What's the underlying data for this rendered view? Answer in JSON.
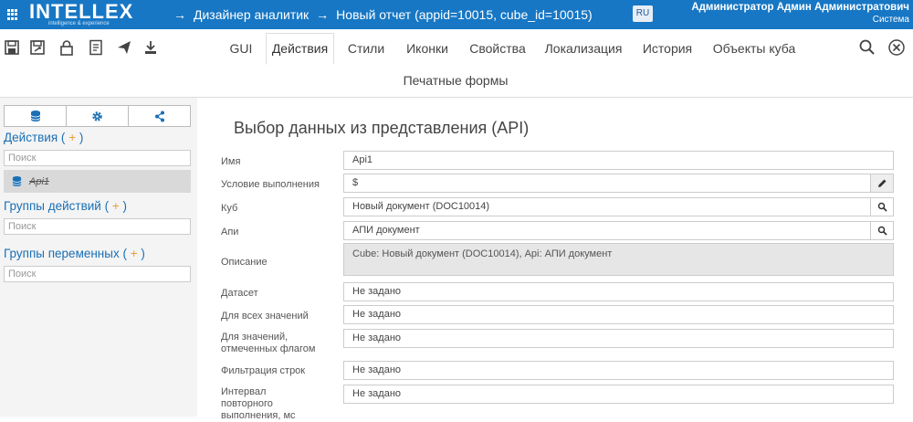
{
  "header": {
    "logo": "INTELLEX",
    "tagline": "intelligence & experience",
    "breadcrumb_1": "Дизайнер аналитик",
    "breadcrumb_2": "Новый отчет (appid=10015, cube_id=10015)",
    "arrow": "→",
    "lang": "RU",
    "user_name": "Администратор Админ Администратович",
    "user_role": "Система",
    "bg_color": "#1777c4"
  },
  "toolbar": {
    "icons": [
      "save-icon",
      "save-as-icon",
      "lock-icon",
      "report-icon",
      "send-icon",
      "export-icon"
    ],
    "tabs": [
      {
        "label": "GUI"
      },
      {
        "label": "Действия",
        "active": true
      },
      {
        "label": "Стили"
      },
      {
        "label": "Иконки"
      },
      {
        "label": "Свойства"
      },
      {
        "label": "Локализация"
      },
      {
        "label": "История"
      },
      {
        "label": "Объекты куба"
      },
      {
        "label": "Печатные формы"
      }
    ],
    "right_icons": [
      "search-icon",
      "close-icon"
    ]
  },
  "sidebar": {
    "tab_icons": [
      "database-icon",
      "gear-icon",
      "share-icon"
    ],
    "actions_label": "Действия",
    "add_open": "(",
    "plus": "+",
    "add_close": ")",
    "actions_search_placeholder": "Поиск",
    "action_item": "Api1",
    "groups_label": "Группы действий",
    "groups_search_placeholder": "Поиск",
    "vars_label": "Группы переменных",
    "vars_search_placeholder": "Поиск",
    "accent_color": "#e8a13b"
  },
  "main": {
    "title": "Выбор данных из представления (API)",
    "fields": [
      {
        "label": "Имя",
        "value": "Api1"
      },
      {
        "label": "Условие выполнения",
        "value": "$"
      },
      {
        "label": "Куб",
        "value": "Новый документ (DOC10014)"
      },
      {
        "label": "Апи",
        "value": "АПИ документ"
      },
      {
        "label": "Описание",
        "value": "Cube: Новый документ (DOC10014), Api: АПИ документ"
      },
      {
        "label": "Датасет",
        "value": "Не задано"
      },
      {
        "label": "Для всех значений",
        "value": "Не задано"
      },
      {
        "label": "Для значений, отмеченных флагом",
        "value": "Не задано"
      },
      {
        "label": "Фильтрация строк",
        "value": "Не задано"
      },
      {
        "label": "Интервал повторного выполнения, мс",
        "value": "Не задано"
      }
    ]
  }
}
